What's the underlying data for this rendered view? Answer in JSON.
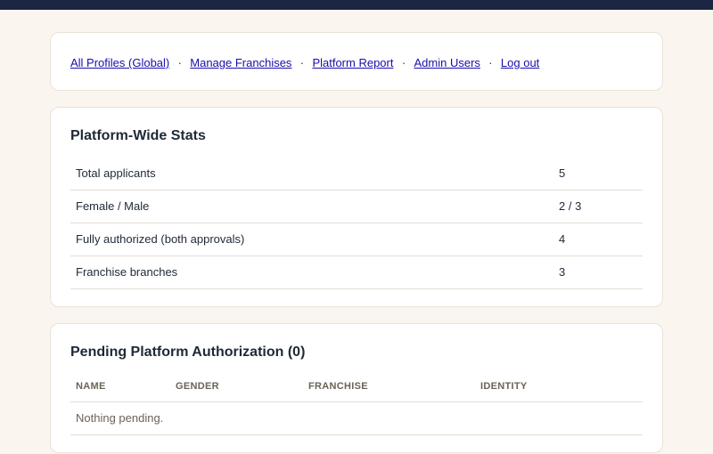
{
  "nav": {
    "links": [
      "All Profiles (Global)",
      "Manage Franchises",
      "Platform Report",
      "Admin Users",
      "Log out"
    ],
    "separator": "·"
  },
  "stats": {
    "title": "Platform-Wide Stats",
    "rows": [
      {
        "label": "Total applicants",
        "value": "5"
      },
      {
        "label": "Female / Male",
        "value": "2 / 3"
      },
      {
        "label": "Fully authorized (both approvals)",
        "value": "4"
      },
      {
        "label": "Franchise branches",
        "value": "3"
      }
    ]
  },
  "pending": {
    "title": "Pending Platform Authorization (0)",
    "columns": [
      "NAME",
      "GENDER",
      "FRANCHISE",
      "IDENTITY"
    ],
    "empty_text": "Nothing pending."
  },
  "colors": {
    "topbar": "#1c2541",
    "background": "#faf5ef",
    "link": "#1a0dab"
  }
}
